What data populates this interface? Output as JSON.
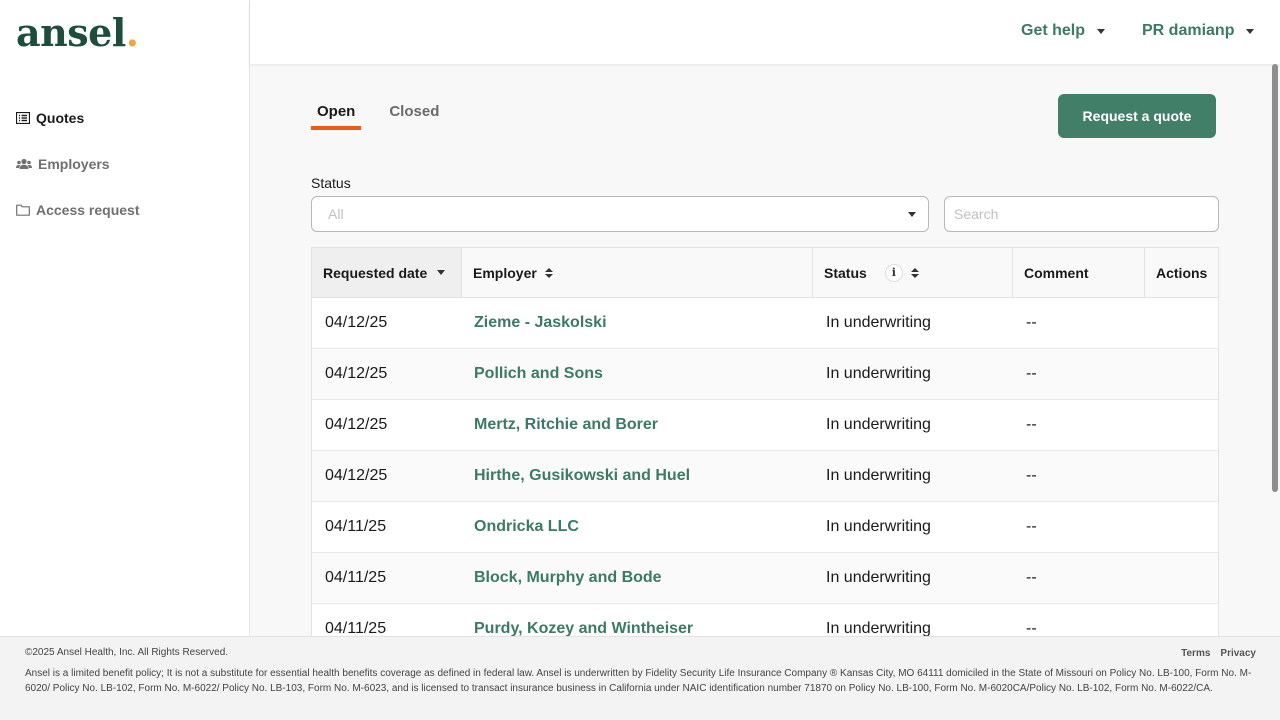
{
  "logo": {
    "text": "ansel",
    "dot": "."
  },
  "sidebar": {
    "items": [
      {
        "label": "Quotes",
        "icon": "list-icon",
        "active": true
      },
      {
        "label": "Employers",
        "icon": "users-icon",
        "active": false
      },
      {
        "label": "Access request",
        "icon": "folder-icon",
        "active": false
      }
    ]
  },
  "header": {
    "help_label": "Get help",
    "user_label": "PR damianp"
  },
  "tabs": [
    {
      "label": "Open",
      "active": true
    },
    {
      "label": "Closed",
      "active": false
    }
  ],
  "request_button": "Request a quote",
  "filters": {
    "status_label": "Status",
    "status_value": "All",
    "search_placeholder": "Search"
  },
  "table": {
    "columns": [
      "Requested date",
      "Employer",
      "Status",
      "Comment",
      "Actions"
    ],
    "rows": [
      {
        "date": "04/12/25",
        "employer": "Zieme - Jaskolski",
        "status": "In underwriting",
        "comment": "--"
      },
      {
        "date": "04/12/25",
        "employer": "Pollich and Sons",
        "status": "In underwriting",
        "comment": "--"
      },
      {
        "date": "04/12/25",
        "employer": "Mertz, Ritchie and Borer",
        "status": "In underwriting",
        "comment": "--"
      },
      {
        "date": "04/12/25",
        "employer": "Hirthe, Gusikowski and Huel",
        "status": "In underwriting",
        "comment": "--"
      },
      {
        "date": "04/11/25",
        "employer": "Ondricka LLC",
        "status": "In underwriting",
        "comment": "--"
      },
      {
        "date": "04/11/25",
        "employer": "Block, Murphy and Bode",
        "status": "In underwriting",
        "comment": "--"
      },
      {
        "date": "04/11/25",
        "employer": "Purdy, Kozey and Wintheiser",
        "status": "In underwriting",
        "comment": "--"
      }
    ]
  },
  "footer": {
    "copyright": "©2025 Ansel Health, Inc. All Rights Reserved.",
    "disclaimer": "Ansel is a limited benefit policy; It is not a substitute for essential health benefits coverage as defined in federal law. Ansel is underwritten by Fidelity Security Life Insurance Company ® Kansas City, MO 64111 domiciled in the State of Missouri on Policy No. LB-100, Form No. M-6020/ Policy No. LB-102, Form No. M-6022/ Policy No. LB-103, Form No. M-6023, and is licensed to transact insurance business in California under NAIC identification number 71870 on Policy No. LB-100, Form No. M-6020CA/Policy No. LB-102, Form No. M-6022/CA.",
    "terms": "Terms",
    "privacy": "Privacy"
  },
  "colors": {
    "brand": "#1f4d3c",
    "accent": "#427f69",
    "tab_underline": "#ee5a17",
    "logo_dot": "#f0a63c"
  }
}
